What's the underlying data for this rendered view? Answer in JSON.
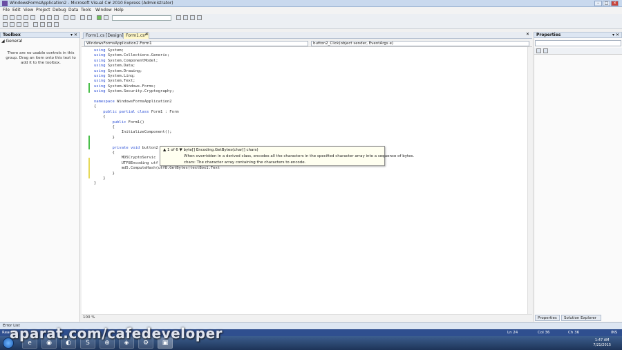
{
  "window": {
    "title": "WindowsFormsApplication2 - Microsoft Visual C# 2010 Express (Administrator)",
    "controls": [
      "–",
      "□",
      "×"
    ]
  },
  "menu": [
    "File",
    "Edit",
    "View",
    "Project",
    "Debug",
    "Data",
    "Tools",
    "Window",
    "Help"
  ],
  "toolbox": {
    "header": "Toolbox",
    "group": "General",
    "empty_message": "There are no usable controls in this group. Drag an item onto this text to add it to the toolbox."
  },
  "tabs": [
    {
      "label": "Form1.cs [Design]*",
      "active": false
    },
    {
      "label": "Form1.cs*",
      "active": true
    }
  ],
  "navigation": {
    "type_combo": "WindowsFormsApplication2.Form1",
    "member_combo": "button2_Click(object sender, EventArgs e)"
  },
  "code_lines": [
    {
      "text": "using System;",
      "kw": "using"
    },
    {
      "text": "using System.Collections.Generic;",
      "kw": "using"
    },
    {
      "text": "using System.ComponentModel;",
      "kw": "using"
    },
    {
      "text": "using System.Data;",
      "kw": "using"
    },
    {
      "text": "using System.Drawing;",
      "kw": "using"
    },
    {
      "text": "using System.Linq;",
      "kw": "using"
    },
    {
      "text": "using System.Text;",
      "kw": "using"
    },
    {
      "text": "using System.Windows.Forms;",
      "kw": "using"
    },
    {
      "text": "using System.Security.Cryptography;",
      "kw": "using"
    },
    {
      "text": "",
      "kw": ""
    },
    {
      "text": "namespace WindowsFormsApplication2",
      "kw": "namespace"
    },
    {
      "text": "{",
      "kw": ""
    },
    {
      "text": "    public partial class Form1 : Form",
      "kw": "public partial class"
    },
    {
      "text": "    {",
      "kw": ""
    },
    {
      "text": "        public Form1()",
      "kw": "public"
    },
    {
      "text": "        {",
      "kw": ""
    },
    {
      "text": "            InitializeComponent();",
      "kw": ""
    },
    {
      "text": "        }",
      "kw": ""
    },
    {
      "text": "",
      "kw": ""
    },
    {
      "text": "        private void button2",
      "kw": "private void"
    },
    {
      "text": "        {",
      "kw": ""
    },
    {
      "text": "            MD5CryptoServic",
      "kw": ""
    },
    {
      "text": "            UTF8Encoding utf",
      "kw": ""
    },
    {
      "text": "            md5.ComputeHash(utf8.GetBytes(textBox1.Text",
      "kw": ""
    },
    {
      "text": "        }",
      "kw": ""
    },
    {
      "text": "    }",
      "kw": ""
    },
    {
      "text": "}",
      "kw": ""
    }
  ],
  "tooltip": {
    "signature": "▲ 1 of 6 ▼  byte[] Encoding.GetBytes(char[] chars)",
    "description": "When overridden in a derived class, encodes all the characters in the specified character array into a sequence of bytes.",
    "param": "chars: The character array containing the characters to encode."
  },
  "editor": {
    "zoom": "100 %"
  },
  "properties": {
    "header": "Properties"
  },
  "bottom_tabs": [
    "Properties",
    "Solution Explorer"
  ],
  "error_list": "Error List",
  "status": {
    "left": "Ready",
    "ln": "Ln 24",
    "col": "Col 36",
    "ch": "Ch 36",
    "ins": "INS"
  },
  "taskbar": {
    "apps": [
      "IE",
      "Chrome",
      "Firefox",
      "Skype",
      "Network",
      "Paint",
      "Tools",
      "VS"
    ],
    "clock_time": "1:47 AM",
    "clock_date": "7/21/2015"
  },
  "watermark": "aparat.com/cafedeveloper",
  "colors": {
    "keyword": "#2b4fd6",
    "type": "#2b91af",
    "status_bar": "#2f4f8f",
    "changed_line_marker": "#4bbf4b"
  }
}
